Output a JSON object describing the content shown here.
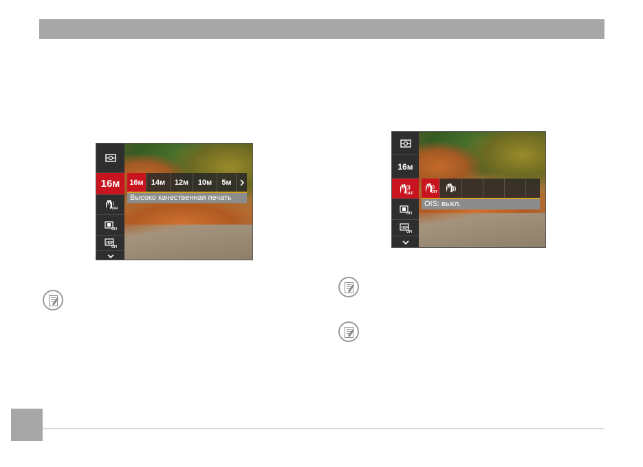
{
  "left_screen": {
    "sidebar": {
      "items": [
        {
          "icon": "metering-icon",
          "label": ""
        },
        {
          "icon": "image-size-icon",
          "label": "16м"
        },
        {
          "icon": "ois-icon",
          "label": ""
        },
        {
          "icon": "continuous-af-icon",
          "label": ""
        },
        {
          "icon": "hdr-icon",
          "label": ""
        }
      ],
      "active_index": 1
    },
    "options": [
      "16м",
      "14м",
      "12м",
      "10м",
      "5м"
    ],
    "selected_index": 0,
    "caption": "Высоко качественная печать"
  },
  "right_screen": {
    "sidebar": {
      "items": [
        {
          "icon": "metering-icon",
          "label": ""
        },
        {
          "icon": "image-size-icon",
          "label": "16м"
        },
        {
          "icon": "ois-off-icon",
          "label": ""
        },
        {
          "icon": "continuous-af-icon",
          "label": ""
        },
        {
          "icon": "hdr-icon",
          "label": ""
        }
      ],
      "active_index": 2
    },
    "options": [
      "ois-off-icon",
      "ois-on-icon"
    ],
    "selected_index": 0,
    "caption": "OIS: выкл."
  },
  "colors": {
    "header_gray": "#a7a7a7",
    "menu_red": "#c8141e",
    "menu_dark": "#2e2e2e",
    "caption_gray": "#8c8c8c",
    "accent_yellow": "#d8a020"
  }
}
